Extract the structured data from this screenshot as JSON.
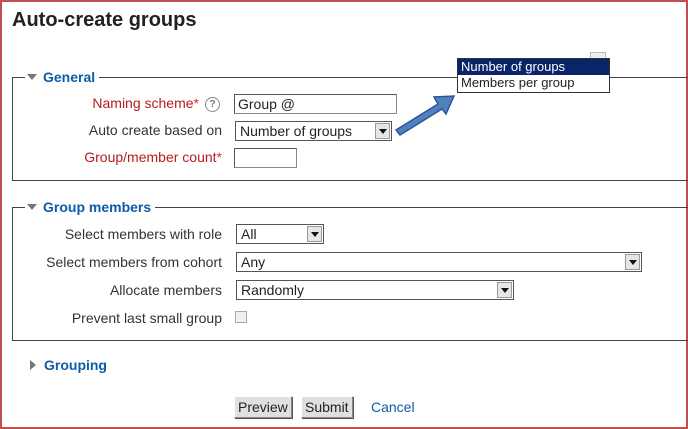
{
  "page": {
    "title": "Auto-create groups"
  },
  "general": {
    "legend": "General",
    "naming_scheme": {
      "label": "Naming scheme",
      "required_mark": "*",
      "value": "Group @",
      "help_icon": "question-mark-icon"
    },
    "auto_create": {
      "label": "Auto create based on",
      "selected": "Number of groups"
    },
    "count": {
      "label": "Group/member count",
      "required_mark": "*",
      "value": ""
    }
  },
  "dropdown_popup": {
    "options": [
      "Number of groups",
      "Members per group"
    ],
    "highlighted": "Number of groups"
  },
  "annotation": {
    "icon": "blue-arrow-icon",
    "color": "#4f81bd"
  },
  "group_members": {
    "legend": "Group members",
    "role": {
      "label": "Select members with role",
      "selected": "All"
    },
    "cohort": {
      "label": "Select members from cohort",
      "selected": "Any"
    },
    "allocate": {
      "label": "Allocate members",
      "selected": "Randomly"
    },
    "prevent": {
      "label": "Prevent last small group",
      "checked": false
    }
  },
  "grouping": {
    "legend": "Grouping"
  },
  "buttons": {
    "preview": "Preview",
    "submit": "Submit",
    "cancel": "Cancel"
  },
  "colors": {
    "heading_link": "#0d5ca7",
    "required": "#b71c1c",
    "frame": "#c0504d"
  }
}
